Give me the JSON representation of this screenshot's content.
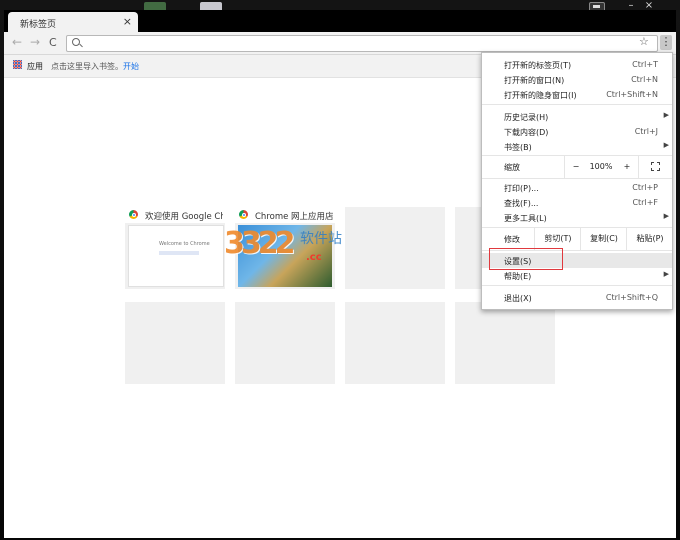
{
  "tab": {
    "title": "新标签页",
    "close": "×"
  },
  "toolbar": {
    "back": "←",
    "forward": "→",
    "reload": "C",
    "star": "☆",
    "menu": "⋮",
    "omnibox_value": ""
  },
  "bookmarks": {
    "apps": "应用",
    "hint": "点击这里导入书签。",
    "link": "开始"
  },
  "tiles": [
    {
      "title": "欢迎使用 Google Chrome",
      "thumb_text": "Welcome to Chrome"
    },
    {
      "title": "Chrome 网上应用店"
    }
  ],
  "watermark": {
    "num": "3322",
    "cn": "软件站",
    "en": ".cc"
  },
  "menu": {
    "new_tab": {
      "label": "打开新的标签页(T)",
      "shortcut": "Ctrl+T"
    },
    "new_window": {
      "label": "打开新的窗口(N)",
      "shortcut": "Ctrl+N"
    },
    "incognito": {
      "label": "打开新的隐身窗口(I)",
      "shortcut": "Ctrl+Shift+N"
    },
    "history": {
      "label": "历史记录(H)"
    },
    "downloads": {
      "label": "下载内容(D)",
      "shortcut": "Ctrl+J"
    },
    "bookmarks": {
      "label": "书签(B)"
    },
    "zoom": {
      "label": "缩放",
      "minus": "−",
      "value": "100%",
      "plus": "+"
    },
    "print": {
      "label": "打印(P)...",
      "shortcut": "Ctrl+P"
    },
    "find": {
      "label": "查找(F)...",
      "shortcut": "Ctrl+F"
    },
    "more_tools": {
      "label": "更多工具(L)"
    },
    "edit": {
      "label": "修改",
      "cut": "剪切(T)",
      "copy": "复制(C)",
      "paste": "粘贴(P)"
    },
    "settings": {
      "label": "设置(S)"
    },
    "help": {
      "label": "帮助(E)"
    },
    "exit": {
      "label": "退出(X)",
      "shortcut": "Ctrl+Shift+Q"
    },
    "submenu_arrow": "▶"
  },
  "window": {
    "min": "–",
    "close": "×"
  },
  "colors": {
    "highlight": "#e0393e",
    "link": "#1a73e8"
  }
}
